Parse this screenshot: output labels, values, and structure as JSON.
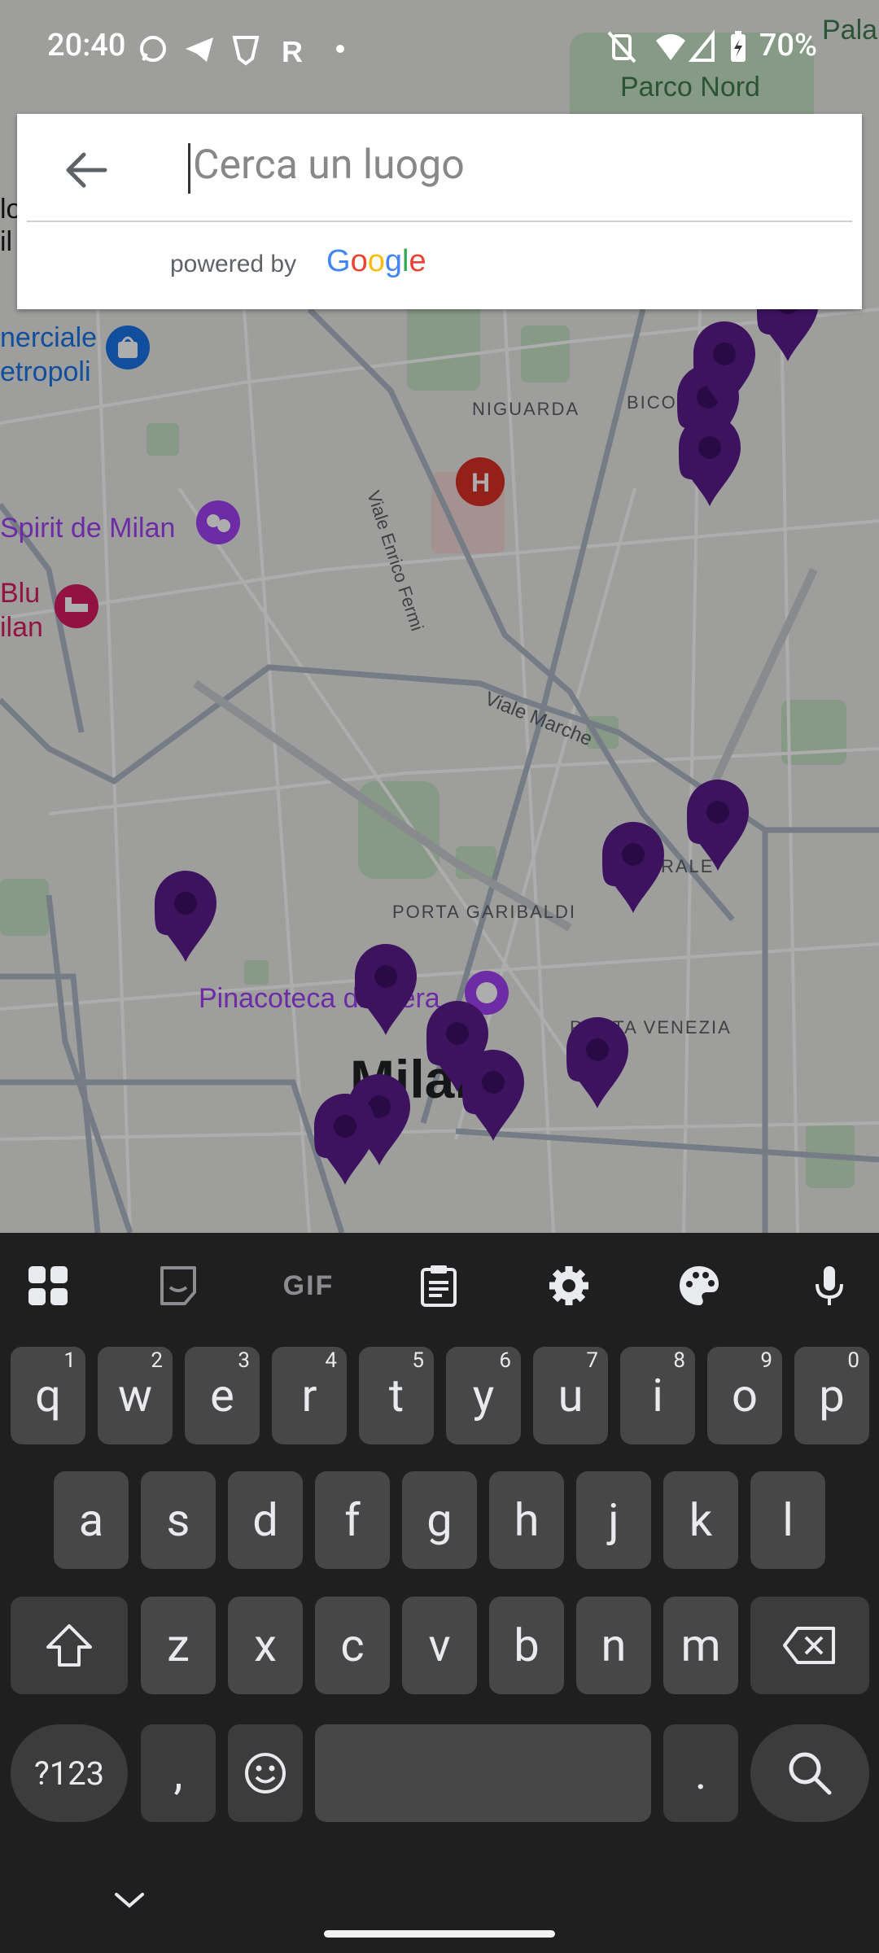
{
  "status_bar": {
    "time": "20:40",
    "battery": "70%",
    "icons": [
      "whatsapp-icon",
      "telegram-icon",
      "vpn-shield-icon",
      "r-app-icon",
      "dot-icon",
      "vibrate-off-icon",
      "wifi-icon",
      "signal-icon",
      "battery-charging-icon"
    ]
  },
  "search": {
    "placeholder": "Cerca un luogo",
    "powered_by": "powered by",
    "google": [
      "G",
      "o",
      "o",
      "g",
      "l",
      "e"
    ],
    "google_colors": [
      "#4285F4",
      "#EA4335",
      "#FBBC05",
      "#4285F4",
      "#34A853",
      "#EA4335"
    ]
  },
  "map": {
    "labels": {
      "parco_nord": "Parco Nord",
      "palazzo_partial": "Pala",
      "commerciale": "nerciale",
      "metropoli": "etropoli",
      "niguarda": "NIGUARDA",
      "bicocca": "BICO",
      "viale_fermi": "Viale Enrico Fermi",
      "spirit": "Spirit de Milan",
      "blu": "Blu",
      "ilan": "ilan",
      "viale_marche": "Viale Marche",
      "rale": "RALE",
      "porta_garibaldi": "PORTA GARIBALDI",
      "pinacoteca": "Pinacoteca di Brera",
      "porta_venezia": "PORTA VENEZIA",
      "milano": "Milano",
      "left_edge_top": "lo",
      "left_edge_top2": "il"
    },
    "marker_color": "#5a1d8c"
  },
  "keyboard": {
    "toolbar": [
      "apps-grid-icon",
      "sticker-icon",
      "gif-icon",
      "clipboard-icon",
      "settings-icon",
      "palette-icon",
      "mic-icon"
    ],
    "gif_label": "GIF",
    "row1": [
      {
        "key": "q",
        "hint": "1"
      },
      {
        "key": "w",
        "hint": "2"
      },
      {
        "key": "e",
        "hint": "3"
      },
      {
        "key": "r",
        "hint": "4"
      },
      {
        "key": "t",
        "hint": "5"
      },
      {
        "key": "y",
        "hint": "6"
      },
      {
        "key": "u",
        "hint": "7"
      },
      {
        "key": "i",
        "hint": "8"
      },
      {
        "key": "o",
        "hint": "9"
      },
      {
        "key": "p",
        "hint": "0"
      }
    ],
    "row2": [
      "a",
      "s",
      "d",
      "f",
      "g",
      "h",
      "j",
      "k",
      "l"
    ],
    "row3": [
      "z",
      "x",
      "c",
      "v",
      "b",
      "n",
      "m"
    ],
    "symbols_key": "?123",
    "comma_key": ",",
    "period_key": "."
  }
}
